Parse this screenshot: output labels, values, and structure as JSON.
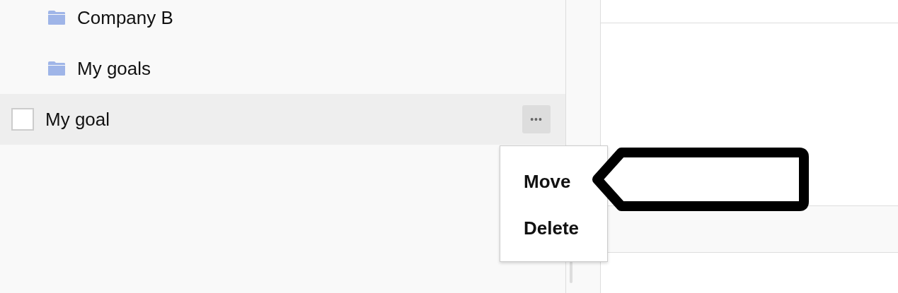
{
  "tree": {
    "items": [
      {
        "kind": "folder",
        "label": "Company B"
      },
      {
        "kind": "folder",
        "label": "My goals"
      },
      {
        "kind": "goal",
        "label": "My goal",
        "checked": false,
        "more": "•••"
      }
    ]
  },
  "context_menu": {
    "items": [
      {
        "label": "Move"
      },
      {
        "label": "Delete"
      }
    ]
  }
}
